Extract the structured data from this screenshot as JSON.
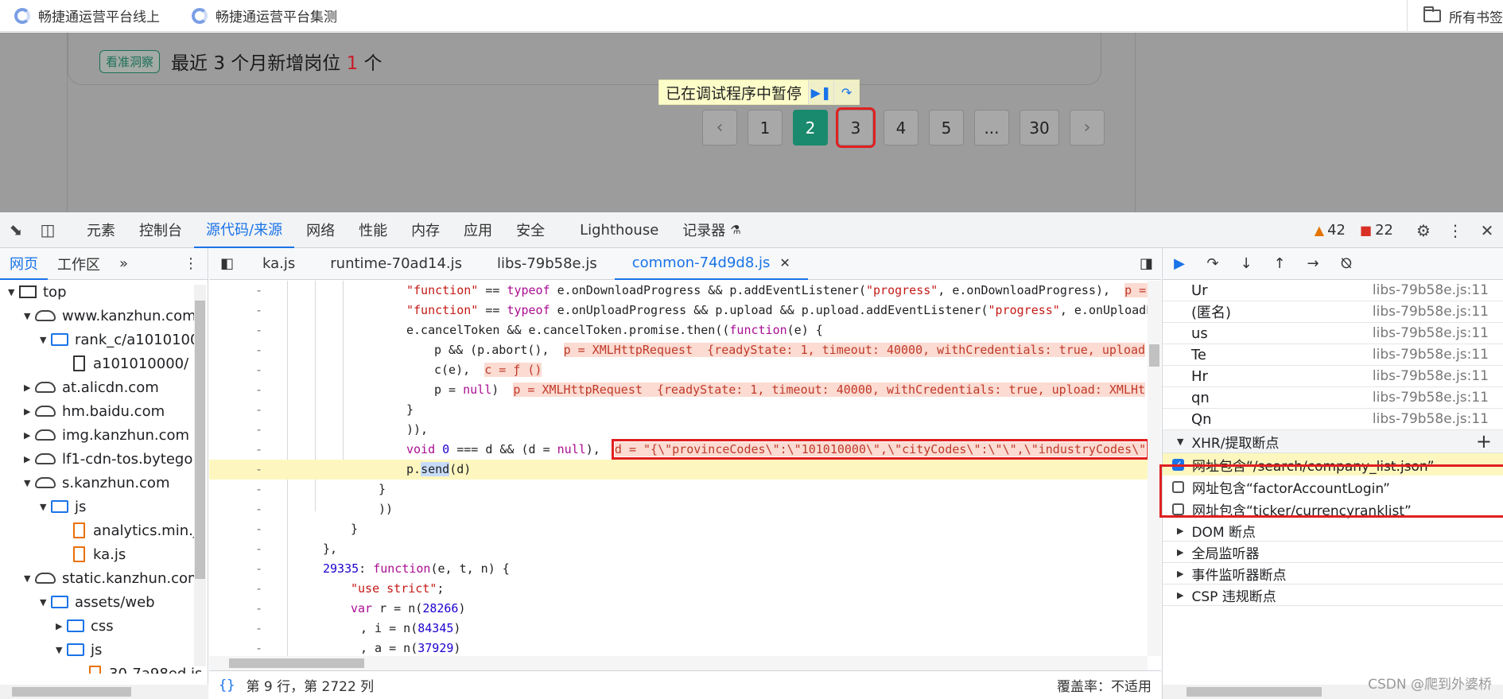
{
  "bookmarks": {
    "items": [
      {
        "label": "畅捷通运营平台线上"
      },
      {
        "label": "畅捷通运营平台集测"
      }
    ],
    "all_bookmarks": "所有书签"
  },
  "page": {
    "insight_tag": "看准洞察",
    "insight_prefix": "最近 3 个月新增岗位 ",
    "insight_number": "1",
    "insight_suffix": " 个",
    "pagination": [
      "1",
      "2",
      "3",
      "4",
      "5",
      "...",
      "30"
    ],
    "active_page": "2",
    "highlighted_page": "3",
    "paused_banner": "已在调试程序中暂停"
  },
  "devtools": {
    "tabs": [
      "元素",
      "控制台",
      "源代码/来源",
      "网络",
      "性能",
      "内存",
      "应用",
      "安全",
      "Lighthouse",
      "记录器"
    ],
    "active_tab": "源代码/来源",
    "warnings": "42",
    "errors": "22",
    "navigator": {
      "tabs": [
        "网页",
        "工作区"
      ],
      "tree": [
        {
          "label": "top",
          "depth": 0,
          "icon": "frame-icon",
          "open": true
        },
        {
          "label": "www.kanzhun.com",
          "depth": 1,
          "icon": "cloud-icon",
          "open": true
        },
        {
          "label": "rank_c/a1010100",
          "depth": 2,
          "icon": "folder-icon",
          "open": true
        },
        {
          "label": "a101010000/",
          "depth": 3,
          "icon": "file-icon",
          "open": null
        },
        {
          "label": "at.alicdn.com",
          "depth": 1,
          "icon": "cloud-icon",
          "open": false
        },
        {
          "label": "hm.baidu.com",
          "depth": 1,
          "icon": "cloud-icon",
          "open": false
        },
        {
          "label": "img.kanzhun.com",
          "depth": 1,
          "icon": "cloud-icon",
          "open": false
        },
        {
          "label": "lf1-cdn-tos.bytego",
          "depth": 1,
          "icon": "cloud-icon",
          "open": false
        },
        {
          "label": "s.kanzhun.com",
          "depth": 1,
          "icon": "cloud-icon",
          "open": true
        },
        {
          "label": "js",
          "depth": 2,
          "icon": "folder-icon",
          "open": true
        },
        {
          "label": "analytics.min.js",
          "depth": 3,
          "icon": "js-file-icon",
          "open": null
        },
        {
          "label": "ka.js",
          "depth": 3,
          "icon": "js-file-icon",
          "open": null
        },
        {
          "label": "static.kanzhun.com",
          "depth": 1,
          "icon": "cloud-icon",
          "open": true
        },
        {
          "label": "assets/web",
          "depth": 2,
          "icon": "folder-icon",
          "open": true
        },
        {
          "label": "css",
          "depth": 3,
          "icon": "folder-icon",
          "open": false
        },
        {
          "label": "js",
          "depth": 3,
          "icon": "folder-icon",
          "open": true
        },
        {
          "label": "30-7a98ed.js",
          "depth": 4,
          "icon": "js-file-icon",
          "open": null
        }
      ]
    },
    "editor": {
      "tabs": [
        "ka.js",
        "runtime-70ad14.js",
        "libs-79b58e.js",
        "common-74d9d8.js"
      ],
      "active_tab": "common-74d9d8.js",
      "status_position": "第 9 行，第 2722 列",
      "coverage": "覆盖率：不适用"
    },
    "sidebar": {
      "call_stack": [
        {
          "name": "Ur",
          "loc": "libs-79b58e.js:11"
        },
        {
          "name": "(匿名)",
          "loc": "libs-79b58e.js:11"
        },
        {
          "name": "us",
          "loc": "libs-79b58e.js:11"
        },
        {
          "name": "Te",
          "loc": "libs-79b58e.js:11"
        },
        {
          "name": "Hr",
          "loc": "libs-79b58e.js:11"
        },
        {
          "name": "qn",
          "loc": "libs-79b58e.js:11"
        },
        {
          "name": "Qn",
          "loc": "libs-79b58e.js:11"
        }
      ],
      "xhr_section": "XHR/提取断点",
      "xhr_breakpoints": [
        {
          "label": "网址包含“/search/company_list.json”",
          "checked": true
        },
        {
          "label": "网址包含“factorAccountLogin”",
          "checked": false
        },
        {
          "label": "网址包含“ticker/currencyranklist”",
          "checked": false
        }
      ],
      "collapsed_sections": [
        "DOM 断点",
        "全局监听器",
        "事件监听器断点",
        "CSP 违规断点"
      ]
    }
  },
  "watermark": "CSDN @爬到外婆桥"
}
